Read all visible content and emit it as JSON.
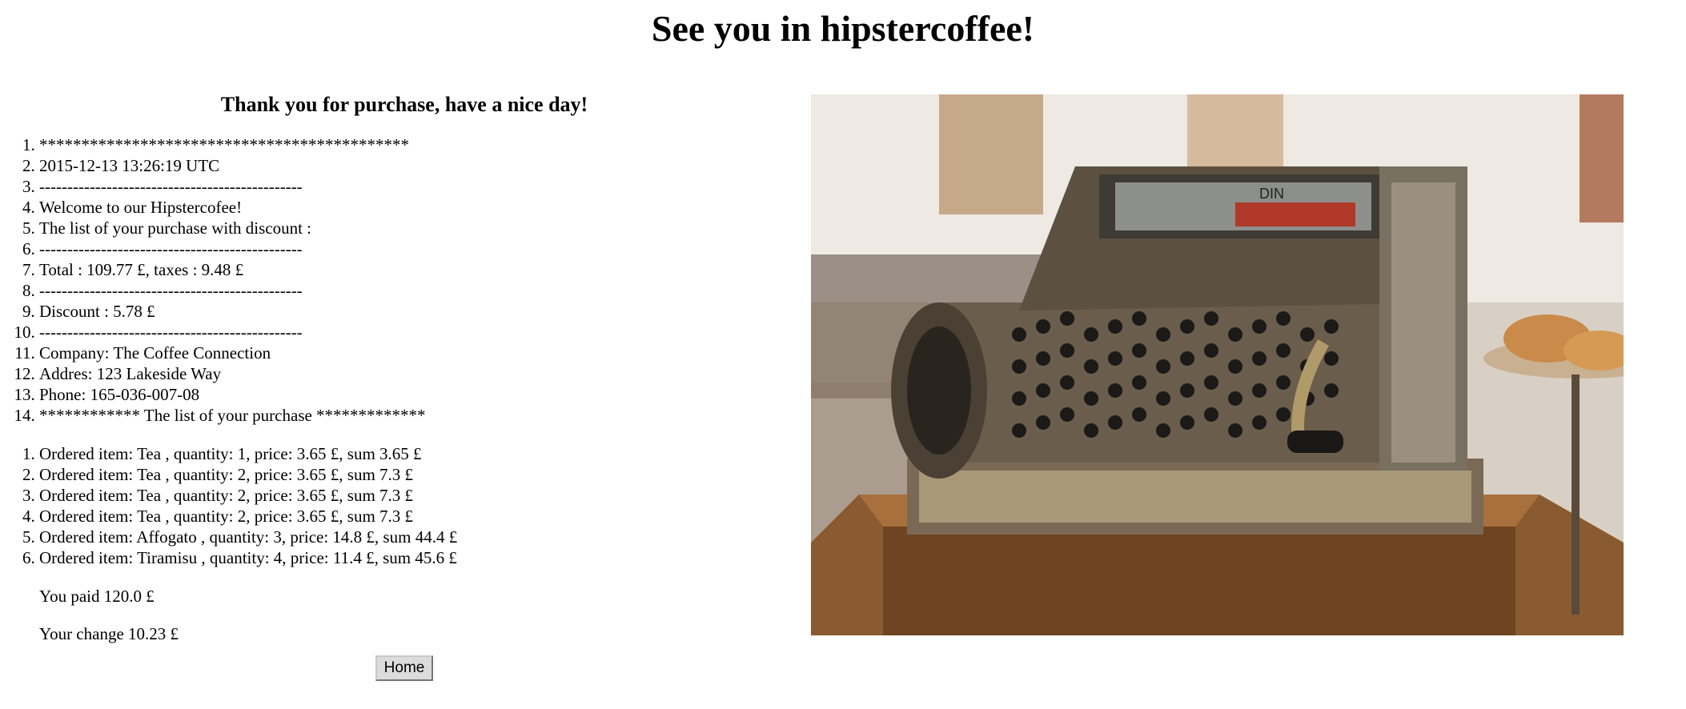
{
  "page": {
    "title": "See you in hipstercoffee!"
  },
  "receipt": {
    "heading": "Thank you for purchase, have a nice day!",
    "lines": [
      "********************************************",
      "2015-12-13 13:26:19 UTC",
      "-----------------------------------------------",
      "Welcome to our Hipstercofee!",
      "The list of your purchase with discount :",
      "-----------------------------------------------",
      "Total : 109.77 £, taxes : 9.48 £",
      "-----------------------------------------------",
      "Discount : 5.78 £",
      "-----------------------------------------------",
      "Company: The Coffee Connection",
      "Addres: 123 Lakeside Way",
      "Phone: 165-036-007-08",
      "************ The list of your purchase *************"
    ],
    "items": [
      "Ordered item: Tea , quantity: 1, price: 3.65 £, sum 3.65 £",
      "Ordered item: Tea , quantity: 2, price: 3.65 £, sum 7.3 £",
      "Ordered item: Tea , quantity: 2, price: 3.65 £, sum 7.3 £",
      "Ordered item: Tea , quantity: 2, price: 3.65 £, sum 7.3 £",
      "Ordered item: Affogato , quantity: 3, price: 14.8 £, sum 44.4 £",
      "Ordered item: Tiramisu , quantity: 4, price: 11.4 £, sum 45.6 £"
    ],
    "paid": "You paid 120.0 £",
    "change": "Your change 10.23 £"
  },
  "buttons": {
    "home_label": "Home"
  },
  "photo": {
    "subject": "antique cash register",
    "register_tag": "DIN"
  }
}
